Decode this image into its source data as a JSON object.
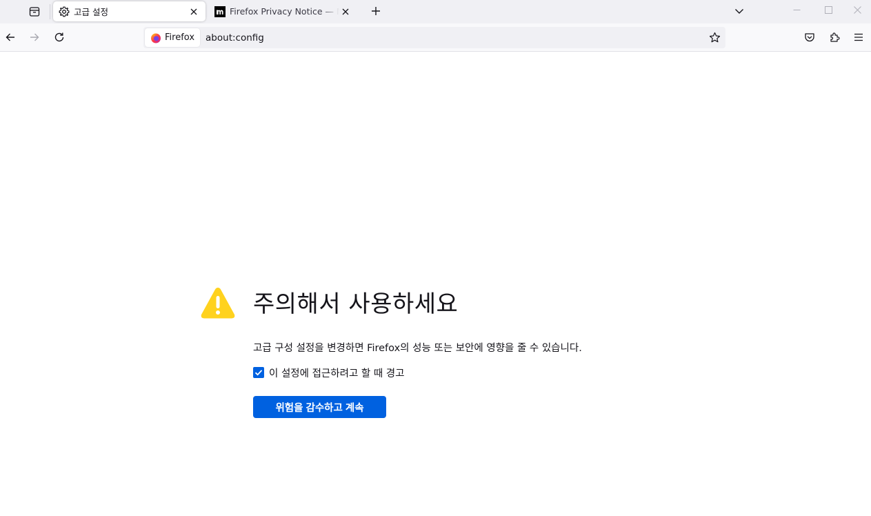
{
  "tabs": [
    {
      "title": "고급 설정",
      "icon": "gear-icon",
      "active": true
    },
    {
      "title": "Firefox Privacy Notice — Mozilla",
      "icon": "mozilla-m-icon",
      "active": false
    }
  ],
  "navbar": {
    "identity_label": "Firefox",
    "url": "about:config"
  },
  "warning": {
    "title": "주의해서 사용하세요",
    "description": "고급 구성 설정을 변경하면 Firefox의 성능 또는 보안에 영향을 줄 수 있습니다.",
    "checkbox_label": "이 설정에 접근하려고 할 때 경고",
    "checkbox_checked": true,
    "accept_button": "위험을 감수하고 계속"
  },
  "colors": {
    "accent": "#0061e0",
    "warning_yellow": "#ffd21e"
  }
}
